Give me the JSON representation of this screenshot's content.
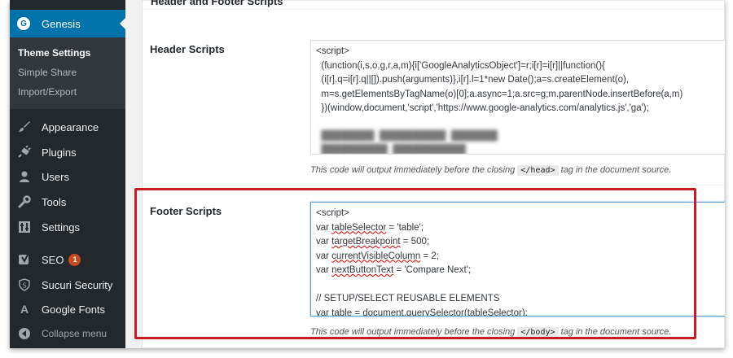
{
  "sidebar": {
    "active": {
      "label": "Genesis",
      "icon": "genesis-g-icon"
    },
    "submenu": [
      {
        "label": "Theme Settings",
        "current": true
      },
      {
        "label": "Simple Share",
        "current": false
      },
      {
        "label": "Import/Export",
        "current": false
      }
    ],
    "items": [
      {
        "label": "Appearance",
        "icon": "paintbrush-icon"
      },
      {
        "label": "Plugins",
        "icon": "plug-icon"
      },
      {
        "label": "Users",
        "icon": "user-icon"
      },
      {
        "label": "Tools",
        "icon": "wrench-icon"
      },
      {
        "label": "Settings",
        "icon": "settings-icon"
      },
      {
        "label": "SEO",
        "icon": "yoast-icon",
        "badge": "1"
      },
      {
        "label": "Sucuri Security",
        "icon": "shield-icon"
      },
      {
        "label": "Google Fonts",
        "icon": "font-icon"
      }
    ],
    "collapse": {
      "label": "Collapse menu",
      "icon": "collapse-icon"
    }
  },
  "content": {
    "section_heading": "Header and Footer Scripts",
    "header_scripts": {
      "label": "Header Scripts",
      "code_lines": [
        "<script>",
        "  (function(i,s,o,g,r,a,m){i['GoogleAnalyticsObject']=r;i[r]=i[r]||function(){",
        "  (i[r].q=i[r].q||[]).push(arguments)},i[r].l=1*new Date();a=s.createElement(o),",
        "  m=s.getElementsByTagName(o)[0];a.async=1;a.src=g;m.parentNode.insertBefore(a,m)",
        "  })(window,document,'script','https://www.google-analytics.com/analytics.js','ga');"
      ],
      "description_pre": "This code will output immediately before the closing ",
      "description_tag": "</head>",
      "description_post": " tag in the document source."
    },
    "footer_scripts": {
      "label": "Footer Scripts",
      "line1": "<script>",
      "line2_pre": "var ",
      "line2_var": "tableSelector",
      "line2_post": " = 'table';",
      "line3_pre": "var ",
      "line3_var": "targetBreakpoint",
      "line3_post": " = 500;",
      "line4_pre": "var ",
      "line4_var": "currentVisibleColumn",
      "line4_post": " = 2;",
      "line5_pre": "var ",
      "line5_var": "nextButtonText",
      "line5_post": " = 'Compare Next';",
      "line6": "// SETUP/SELECT REUSABLE ELEMENTS",
      "line7_pre": "var table = ",
      "line7_call": "document.querySelector",
      "line7_paren": "(",
      "line7_arg": "tableSelector",
      "line7_post": ");",
      "description_pre": "This code will output immediately before the closing ",
      "description_tag": "</body>",
      "description_post": " tag in the document source."
    }
  },
  "colors": {
    "admin_bar": "#23282d",
    "active_blue": "#0073aa",
    "highlight_red": "#c91d23",
    "badge_orange": "#ca4a1f"
  }
}
